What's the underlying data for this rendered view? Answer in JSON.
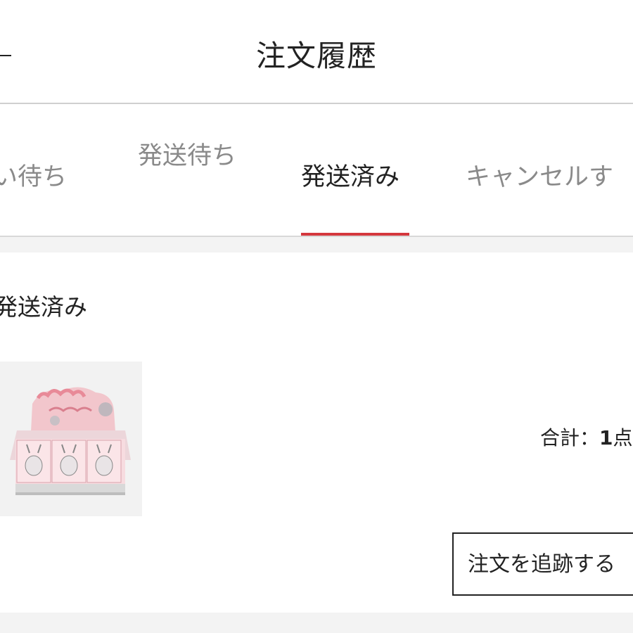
{
  "header": {
    "title": "注文履歴"
  },
  "tabs": [
    {
      "label": "い待ち",
      "active": false
    },
    {
      "label": "発送待ち",
      "active": false
    },
    {
      "label": "発送済み",
      "active": true
    },
    {
      "label": "キャンセルす",
      "active": false
    }
  ],
  "order": {
    "status": "発送済み",
    "total_prefix": "合計：",
    "total_count": "1",
    "total_suffix": "点",
    "track_button_label": "注文を追跡する"
  },
  "colors": {
    "accent": "#d4373d"
  }
}
